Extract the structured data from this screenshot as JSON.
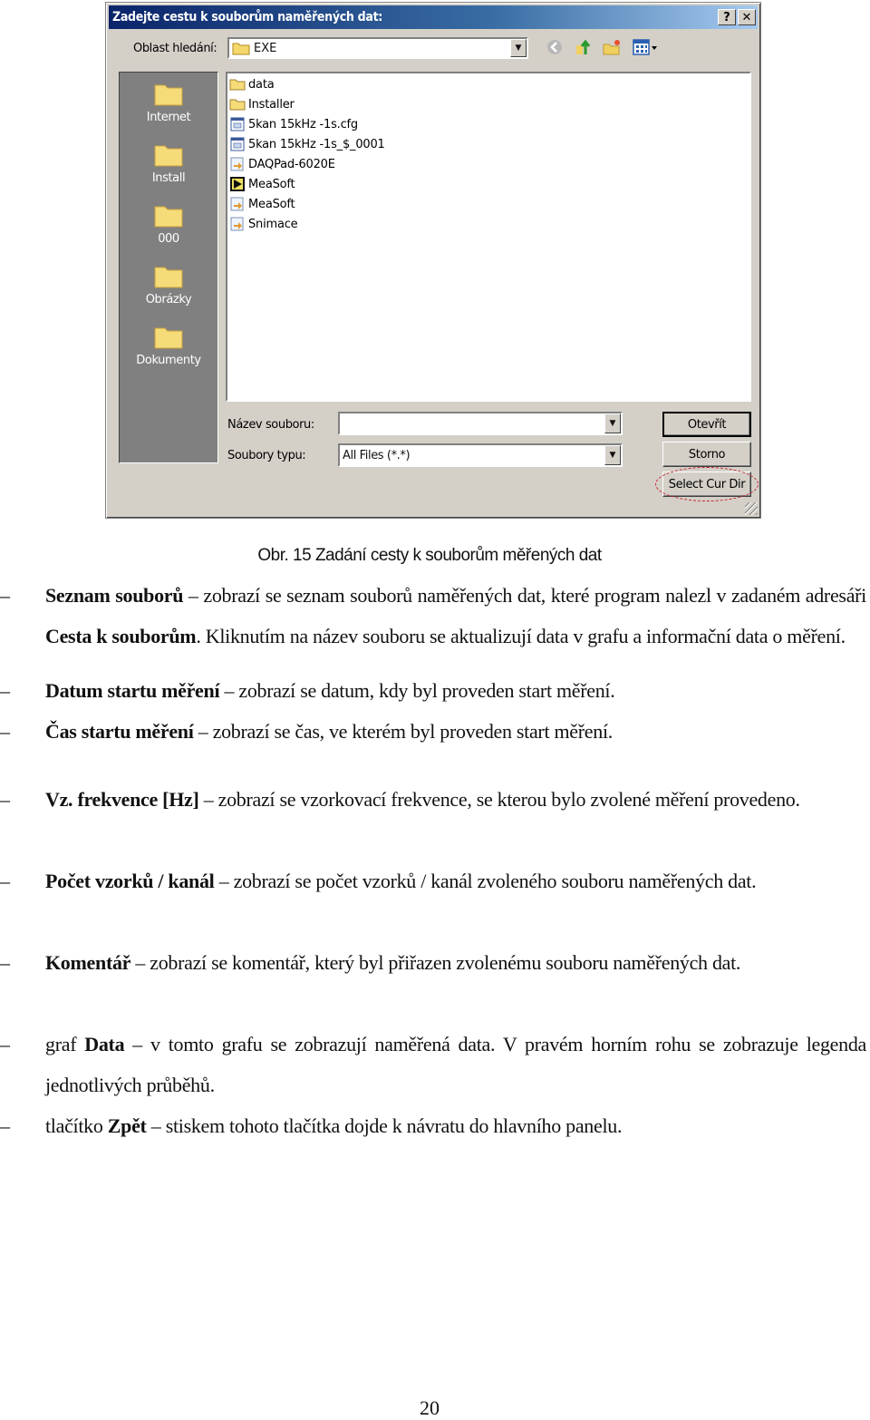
{
  "dialog": {
    "title": "Zadejte cestu k souborům naměřených dat:",
    "help_button": "?",
    "close_button": "✕",
    "look_in_label": "Oblast hledání:",
    "look_in_value": "EXE",
    "toolbar": [
      "back-icon",
      "up-folder-icon",
      "new-folder-icon",
      "view-menu-icon"
    ],
    "places": [
      {
        "label": "Internet"
      },
      {
        "label": "Install"
      },
      {
        "label": "000"
      },
      {
        "label": "Obrázky"
      },
      {
        "label": "Dokumenty"
      }
    ],
    "files": [
      {
        "name": "data",
        "icon": "folder-icon"
      },
      {
        "name": "Installer",
        "icon": "folder-icon"
      },
      {
        "name": "5kan 15kHz -1s.cfg",
        "icon": "config-file-icon"
      },
      {
        "name": "5kan 15kHz -1s_$_0001",
        "icon": "config-file-icon"
      },
      {
        "name": "DAQPad-6020E",
        "icon": "shortcut-file-icon"
      },
      {
        "name": "MeaSoft",
        "icon": "labview-app-icon"
      },
      {
        "name": "MeaSoft",
        "icon": "shortcut-file-icon"
      },
      {
        "name": "Snimace",
        "icon": "shortcut-file-icon"
      }
    ],
    "file_name_label": "Název souboru:",
    "file_name_value": "",
    "file_type_label": "Soubory typu:",
    "file_type_value": "All Files (*.*)",
    "open_button": "Otevřít",
    "cancel_button": "Storno",
    "select_dir_button": "Select Cur Dir",
    "highlight_color": "#c8202a"
  },
  "caption": "Obr. 15 Zadání cesty k souborům měřených dat",
  "items": [
    {
      "bold": "Seznam souborů",
      "pre": "",
      "text": " – zobrazí se seznam souborů naměřených dat, které program nalezl v zadaném adresáři ",
      "bold2": "Cesta k souborům",
      "text2": ". Kliknutím na název souboru se aktualizují data v grafu a informační data o měření."
    },
    {
      "bold": "Datum startu měření",
      "pre": "",
      "text": " – zobrazí se datum, kdy byl proveden start měření.",
      "bold2": "",
      "text2": ""
    },
    {
      "bold": "Čas startu měření",
      "pre": "",
      "text": " – zobrazí se čas, ve kterém byl proveden start měření.",
      "bold2": "",
      "text2": ""
    },
    {
      "bold": "Vz. frekvence [Hz]",
      "pre": "",
      "text": " – zobrazí se vzorkovací frekvence, se kterou bylo zvolené měření provedeno.",
      "bold2": "",
      "text2": ""
    },
    {
      "bold": "Počet vzorků / kanál",
      "pre": "",
      "text": " – zobrazí se počet vzorků / kanál zvoleného souboru naměřených dat.",
      "bold2": "",
      "text2": ""
    },
    {
      "bold": "Komentář",
      "pre": "",
      "text": " – zobrazí se komentář, který byl přiřazen zvolenému souboru naměřených dat.",
      "bold2": "",
      "text2": ""
    },
    {
      "bold": "Data",
      "pre": "graf ",
      "text": " – v tomto grafu se zobrazují naměřená data. V pravém horním rohu se zobrazuje legenda jednotlivých průběhů.",
      "bold2": "",
      "text2": ""
    },
    {
      "bold": "Zpět",
      "pre": "tlačítko ",
      "text": " – stiskem tohoto tlačítka dojde k návratu do hlavního panelu.",
      "bold2": "",
      "text2": ""
    }
  ],
  "dash": "–",
  "page_number": "20"
}
